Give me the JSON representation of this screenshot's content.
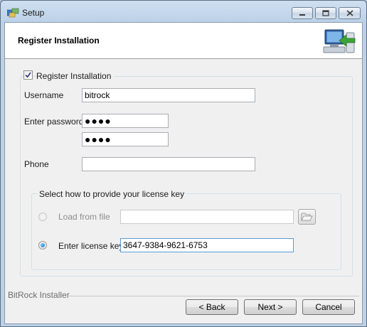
{
  "window": {
    "title": "Setup"
  },
  "header": {
    "title": "Register Installation"
  },
  "register_checkbox": {
    "label": "Register Installation",
    "checked": true
  },
  "form": {
    "username_label": "Username",
    "username_value": "bitrock",
    "password_label": "Enter password",
    "password_mask": "●●●●",
    "confirm_mask": "●●●●",
    "phone_label": "Phone",
    "phone_value": ""
  },
  "license": {
    "group_title": "Select how to provide your license key",
    "option_file_label": "Load from file",
    "option_file_value": "",
    "option_key_label": "Enter license key",
    "option_key_value": "3647-9384-9621-6753",
    "selected": "key"
  },
  "footer": {
    "installer_name": "BitRock Installer",
    "back_label": "< Back",
    "next_label": "Next >",
    "cancel_label": "Cancel"
  },
  "icons": {
    "app": "setup-app-icon",
    "header": "register-computer-icon",
    "browse": "folder-open-icon"
  }
}
